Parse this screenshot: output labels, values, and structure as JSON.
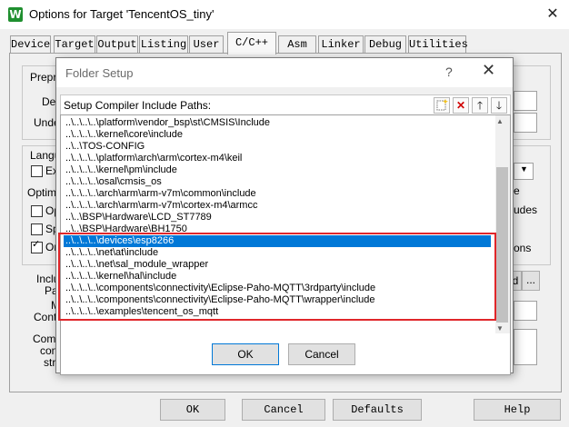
{
  "window": {
    "title": "Options for Target 'TencentOS_tiny'",
    "logo_letter": "W",
    "close_glyph": "✕"
  },
  "tabs": [
    {
      "label": "Device"
    },
    {
      "label": "Target"
    },
    {
      "label": "Output"
    },
    {
      "label": "Listing"
    },
    {
      "label": "User"
    },
    {
      "label": "C/C++"
    },
    {
      "label": "Asm"
    },
    {
      "label": "Linker"
    },
    {
      "label": "Debug"
    },
    {
      "label": "Utilities"
    }
  ],
  "background_fragments": {
    "prepro": "Prepro",
    "def": "Def",
    "undef": "Undef",
    "langu": "Langu",
    "ex": "Ex",
    "optimiz": "Optimiz",
    "op": "Op",
    "sp": "Sp",
    "or": "Or",
    "inclu": "Inclu",
    "pat": "Pat",
    "m": "M",
    "contr": "Contr",
    "comp": "Comp",
    "cont": "cont",
    "str": "str",
    "e": "e",
    "udes": "udes",
    "ons": "ons",
    "d": "d",
    "ellipsis": "..."
  },
  "bottom_buttons": {
    "ok": "OK",
    "cancel": "Cancel",
    "defaults": "Defaults",
    "help": "Help"
  },
  "dialog": {
    "title": "Folder Setup",
    "help_glyph": "?",
    "close_glyph": "✕",
    "header_label": "Setup Compiler Include Paths:",
    "toolbar": {
      "new_icon": "new-folder-icon",
      "delete_glyph": "✕",
      "up_glyph": "🡑",
      "down_glyph": "🡓"
    },
    "paths": [
      "..\\..\\..\\..\\platform\\vendor_bsp\\st\\CMSIS\\Include",
      "..\\..\\..\\..\\kernel\\core\\include",
      "..\\..\\TOS-CONFIG",
      "..\\..\\..\\..\\platform\\arch\\arm\\cortex-m4\\keil",
      "..\\..\\..\\..\\kernel\\pm\\include",
      "..\\..\\..\\..\\osal\\cmsis_os",
      "..\\..\\..\\..\\arch\\arm\\arm-v7m\\common\\include",
      "..\\..\\..\\..\\arch\\arm\\arm-v7m\\cortex-m4\\armcc",
      "..\\..\\BSP\\Hardware\\LCD_ST7789",
      "..\\..\\BSP\\Hardware\\BH1750",
      "..\\..\\..\\..\\devices\\esp8266",
      "..\\..\\..\\..\\net\\at\\include",
      "..\\..\\..\\..\\net\\sal_module_wrapper",
      "..\\..\\..\\..\\kernel\\hal\\include",
      "..\\..\\..\\..\\components\\connectivity\\Eclipse-Paho-MQTT\\3rdparty\\include",
      "..\\..\\..\\..\\components\\connectivity\\Eclipse-Paho-MQTT\\wrapper\\include",
      "..\\..\\..\\..\\examples\\tencent_os_mqtt"
    ],
    "selected_index": 10,
    "ok_label": "OK",
    "cancel_label": "Cancel"
  },
  "colors": {
    "selection": "#0078d7",
    "highlight_box": "#e0262a"
  }
}
